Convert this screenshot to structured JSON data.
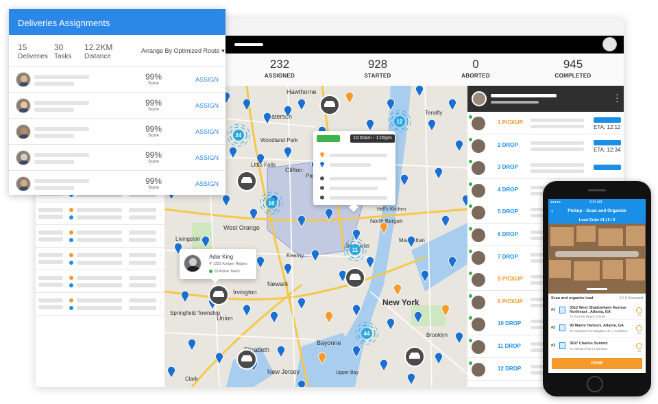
{
  "stats": [
    {
      "value": "232",
      "label": "ASSIGNED"
    },
    {
      "value": "928",
      "label": "STARTED"
    },
    {
      "value": "0",
      "label": "ABORTED"
    },
    {
      "value": "945",
      "label": "COMPLETED"
    }
  ],
  "deliveries_panel": {
    "title": "Deliveries Assignments",
    "summary": [
      {
        "value": "15",
        "label": "Deliveries"
      },
      {
        "value": "30",
        "label": "Tasks"
      },
      {
        "value": "12.2KM",
        "label": "Distance"
      }
    ],
    "arrange_label": "Arrange By Optimized Route",
    "arrange_caret": "▾",
    "rows": [
      {
        "score": "99%",
        "score_label": "Score",
        "action": "ASSIGN"
      },
      {
        "score": "99%",
        "score_label": "Score",
        "action": "ASSIGN"
      },
      {
        "score": "99%",
        "score_label": "Score",
        "action": "ASSIGN"
      },
      {
        "score": "99%",
        "score_label": "Score",
        "action": "ASSIGN"
      },
      {
        "score": "99%",
        "score_label": "Score",
        "action": "ASSIGN"
      }
    ]
  },
  "map": {
    "places": [
      {
        "name": "Hawthorne"
      },
      {
        "name": "Paterson"
      },
      {
        "name": "Woodland Park"
      },
      {
        "name": "Little Falls"
      },
      {
        "name": "Clifton"
      },
      {
        "name": "Passaic"
      },
      {
        "name": "West Orange"
      },
      {
        "name": "Livingston"
      },
      {
        "name": "Kearny"
      },
      {
        "name": "Newark"
      },
      {
        "name": "Irvington"
      },
      {
        "name": "Union"
      },
      {
        "name": "Springfield Township"
      },
      {
        "name": "Elizabeth"
      },
      {
        "name": "Clark"
      },
      {
        "name": "Bayonne"
      },
      {
        "name": "New York"
      },
      {
        "name": "Manhattan"
      },
      {
        "name": "Brooklyn"
      },
      {
        "name": "Secaucus"
      },
      {
        "name": "North Bergen"
      },
      {
        "name": "Tenafly"
      },
      {
        "name": "Hell's Kitchen"
      },
      {
        "name": "New Jersey"
      },
      {
        "name": "Upper Bay"
      }
    ],
    "clusters": [
      "24",
      "16",
      "12",
      "11",
      "44"
    ],
    "info_card": {
      "time_window": "10:00am - 1:00pm"
    },
    "driver_card": {
      "name": "Adar King",
      "address": "1323 Kreiger Ridges",
      "tasks": "23 Active Tasks"
    }
  },
  "drivers_panel": {
    "rows": [
      {
        "tag": "1 PICKUP",
        "kind": "pickup",
        "eta": "ETA: 12:12"
      },
      {
        "tag": "2 DROP",
        "kind": "drop",
        "eta": "ETA: 12:34"
      },
      {
        "tag": "3 DROP",
        "kind": "drop",
        "eta": ""
      },
      {
        "tag": "4 DROP",
        "kind": "drop",
        "eta": ""
      },
      {
        "tag": "5 DROP",
        "kind": "drop",
        "eta": ""
      },
      {
        "tag": "6 DROP",
        "kind": "drop",
        "eta": ""
      },
      {
        "tag": "7 DROP",
        "kind": "drop",
        "eta": ""
      },
      {
        "tag": "8 PICKUP",
        "kind": "pickup",
        "eta": ""
      },
      {
        "tag": "9 PICKUP",
        "kind": "pickup",
        "eta": ""
      },
      {
        "tag": "10 DROP",
        "kind": "drop",
        "eta": ""
      },
      {
        "tag": "11 DROP",
        "kind": "drop",
        "eta": ""
      },
      {
        "tag": "12 DROP",
        "kind": "drop",
        "eta": ""
      }
    ]
  },
  "phone": {
    "status_carrier": "●●●●● ",
    "status_time": "9:41 AM",
    "back_icon": "‹",
    "nav_title": "Pickup - Scan and Organize",
    "load_order": "Load Order #1 | 0 / 3",
    "scan_title": "Scan and organize load",
    "scan_count": "0 / 9 Scanned",
    "items": [
      {
        "num": "#1",
        "address": "3312 West Shadowlawn Avenue",
        "address2": "Northeast , Atlanta, GA",
        "to": "To: Kenneth Meyer | 3 Items",
        "count": "0/3"
      },
      {
        "num": "#2",
        "address": "99 Mante Harbors, Atlanta, GA",
        "address2": "",
        "to": "To: Theodora Technologies LTD | 1 Small Box",
        "count": "0/1"
      },
      {
        "num": "#3",
        "address": "3637 Charles Summit",
        "address2": "",
        "to": "To: Norman Flow | 1 Med Box",
        "count": "0/5"
      }
    ],
    "done_label": "DONE"
  },
  "colors": {
    "primary": "#2b87e8",
    "pickup": "#f59a2b",
    "online": "#2ab34a",
    "topbar": "#000000"
  }
}
